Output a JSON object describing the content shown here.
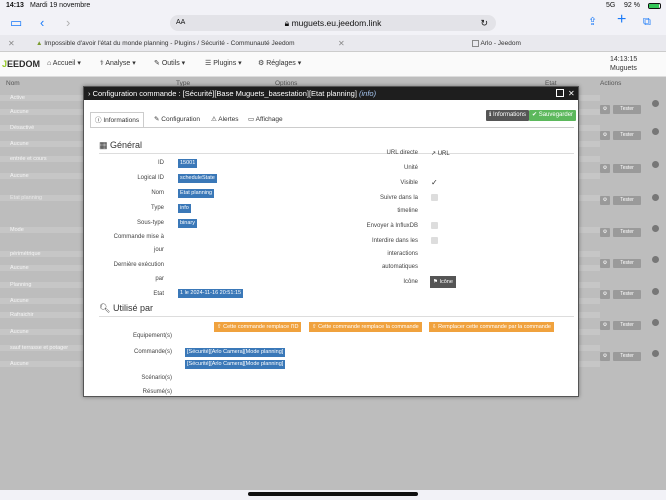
{
  "status": {
    "time": "14:13",
    "date": "Mardi 19 novembre",
    "signal": "5G",
    "battery": "92 %"
  },
  "browser": {
    "url": "muguets.eu.jeedom.link",
    "aa": "AA",
    "tab1": "Impossible d'avoir l'état du monde planning - Plugins / Sécurité - Communauté Jeedom",
    "tab2": "Arlo - Jeedom"
  },
  "app": {
    "logo": "EEDOM",
    "menus": [
      "Accueil",
      "Analyse",
      "Outils",
      "Plugins",
      "Réglages"
    ],
    "clock": "14:13:15",
    "site": "Muguets",
    "columns": [
      "Nom",
      "Type",
      "Options",
      "Etat",
      "Actions"
    ],
    "rows": [
      "Active",
      "Aucune",
      "Désactivé",
      "Aucune",
      "entrée et cours",
      "Aucune",
      "Etat planning",
      "Mode",
      "périmétrique",
      "Aucune",
      "Planning",
      "Aucune",
      "Rafraichir",
      "Aucune",
      "sauf terrasse et potager",
      "Aucune"
    ],
    "tester_label": "Tester"
  },
  "modal": {
    "title": "Configuration commande : [Sécurité][Base Muguets_basestation][Etat planning]",
    "title_info": "(info)",
    "tabs": [
      "Informations",
      "Configuration",
      "Alertes",
      "Affichage"
    ],
    "btn_info": "Informations",
    "btn_save": "Sauvegarder",
    "general": "Général",
    "fields": [
      {
        "label": "ID",
        "value": "15001"
      },
      {
        "label": "Logical ID",
        "value": "scheduleState"
      },
      {
        "label": "Nom",
        "value": "Etat planning"
      },
      {
        "label": "Type",
        "value": "info"
      },
      {
        "label": "Sous-type",
        "value": "binary"
      }
    ],
    "cmd_mise": "Commande mise à",
    "cmd_mise2": "jour",
    "derniere": "Dernière exécution",
    "derniere2": "par",
    "etat_label": "Etat",
    "etat_value": "1 le 2024-11-16 20:51:15",
    "right_labels": [
      "URL directe",
      "Unité",
      "Visible",
      "Suivre dans la",
      "timeline",
      "Envoyer à InfluxDB",
      "Interdire dans les",
      "interactions",
      "automatiques",
      "Icône"
    ],
    "url_link": "URL",
    "icon_btn": "Icône",
    "utilise": "Utilisé par",
    "orange1": "Cette commande remplace l'ID",
    "orange2": "Cette commande remplace la commande",
    "orange3": "Remplacer cette commande par la commande",
    "equip": "Equipement(s)",
    "cmds": "Commande(s)",
    "cmd1": "[Sécurité][Arlo Camera][Mode planning]",
    "cmd2": "[Sécurité][Arlo Camera][Mode planning]",
    "scenario": "Scénario(s)",
    "resume": "Résumé(s)"
  }
}
